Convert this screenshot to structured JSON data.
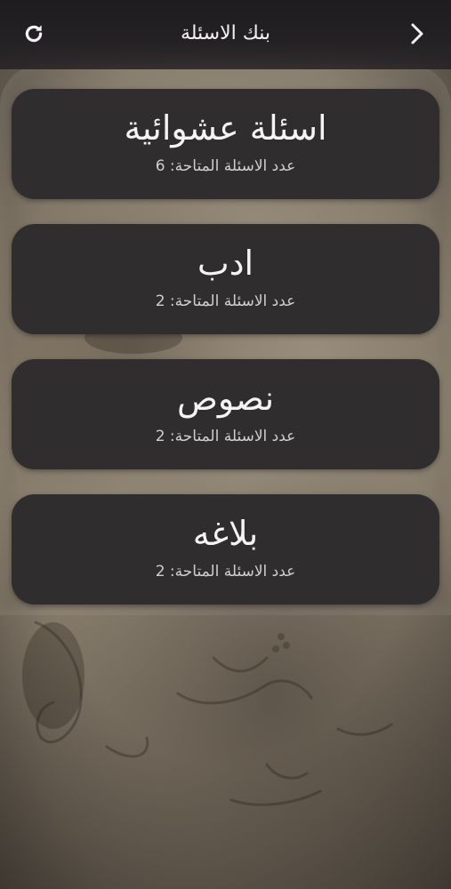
{
  "header": {
    "title": "بنك الاسئلة",
    "refresh_icon": "refresh-icon",
    "back_icon": "chevron-right-icon"
  },
  "categories": [
    {
      "title": "اسئلة عشوائية",
      "subtitle": "عدد الاسئلة المتاحة: 6"
    },
    {
      "title": "ادب",
      "subtitle": "عدد الاسئلة المتاحة: 2"
    },
    {
      "title": "نصوص",
      "subtitle": "عدد الاسئلة المتاحة: 2"
    },
    {
      "title": "بلاغه",
      "subtitle": "عدد الاسئلة المتاحة: 2"
    }
  ],
  "colors": {
    "header_bg": "#242124",
    "card_bg": "#2f2d2e",
    "text_primary": "#f4f4f4",
    "text_secondary": "#cfcfcf"
  }
}
